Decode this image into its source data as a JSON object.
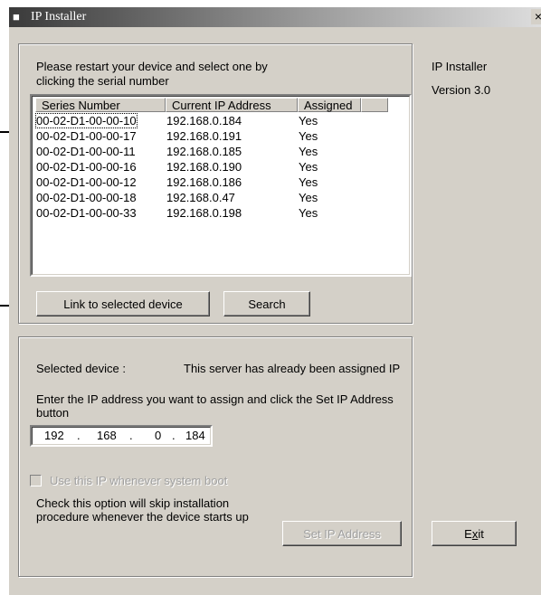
{
  "window": {
    "title": "IP Installer",
    "close_glyph": "×",
    "icon": "app-icon"
  },
  "instructions": {
    "line1": "Please restart your device and select one by",
    "line2": "clicking the serial number"
  },
  "about": {
    "name": "IP Installer",
    "version": "Version 3.0"
  },
  "device_list": {
    "columns": [
      "Series Number",
      "Current IP Address",
      "Assigned"
    ],
    "rows": [
      {
        "serial": "00-02-D1-00-00-10",
        "ip": "192.168.0.184",
        "assigned": "Yes"
      },
      {
        "serial": "00-02-D1-00-00-17",
        "ip": "192.168.0.191",
        "assigned": "Yes"
      },
      {
        "serial": "00-02-D1-00-00-11",
        "ip": "192.168.0.185",
        "assigned": "Yes"
      },
      {
        "serial": "00-02-D1-00-00-16",
        "ip": "192.168.0.190",
        "assigned": "Yes"
      },
      {
        "serial": "00-02-D1-00-00-12",
        "ip": "192.168.0.186",
        "assigned": "Yes"
      },
      {
        "serial": "00-02-D1-00-00-18",
        "ip": "192.168.0.47",
        "assigned": "Yes"
      },
      {
        "serial": "00-02-D1-00-00-33",
        "ip": "192.168.0.198",
        "assigned": "Yes"
      }
    ],
    "selected_index": 0
  },
  "buttons": {
    "link": "Link to selected device",
    "search": "Search",
    "set_ip": "Set IP Address",
    "exit_pre": "E",
    "exit_mnemonic": "x",
    "exit_post": "it"
  },
  "assign": {
    "selected_label": "Selected device :",
    "selected_status": "This server has already been assigned IP",
    "prompt_line1": "Enter the IP address you want to assign and click the Set IP Address",
    "prompt_line2": "button",
    "ip_octets": [
      "192",
      "168",
      "0",
      "184"
    ],
    "ip_separator": ".",
    "checkbox_label": "Use this IP whenever system boot",
    "checkbox_checked": false,
    "note_line1": "Check this option will skip installation",
    "note_line2": "procedure whenever the device starts up"
  },
  "colors": {
    "window_bg": "#d4d0c8",
    "title_gradient_start": "#3a3a3a",
    "title_gradient_end": "#e0e0e0"
  }
}
